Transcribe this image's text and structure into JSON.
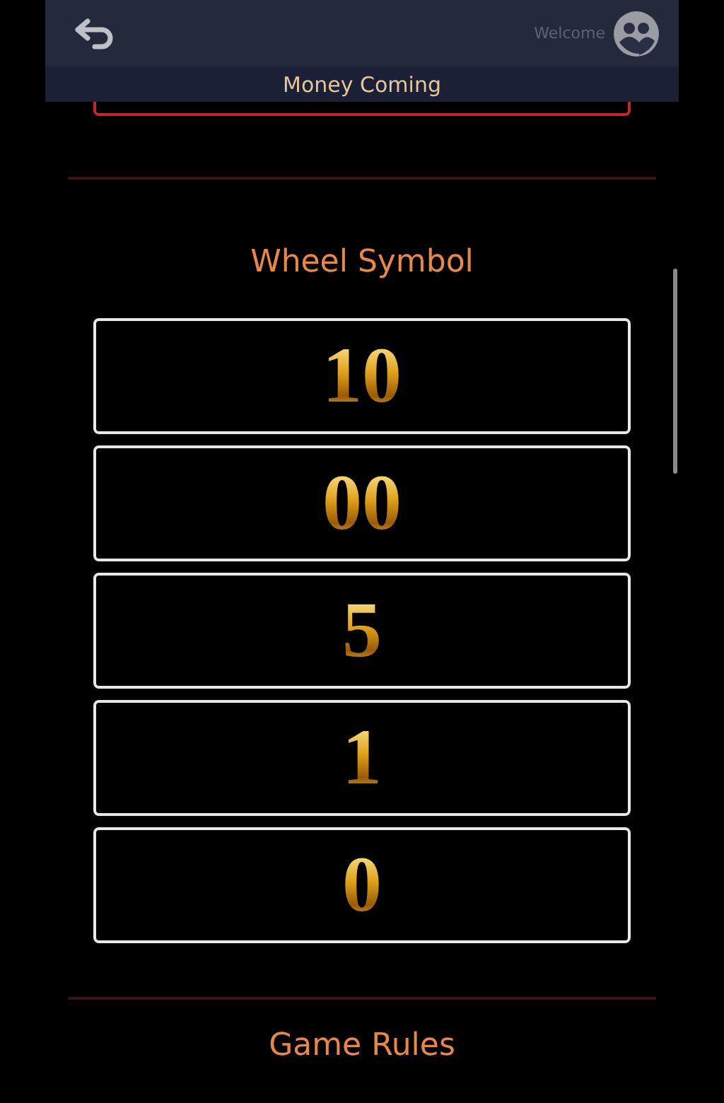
{
  "header": {
    "welcome": "Welcome",
    "title": "Money Coming"
  },
  "section_title": "Wheel Symbol",
  "symbols": [
    "10",
    "00",
    "5",
    "1",
    "0"
  ],
  "next_section_title": "Game Rules"
}
